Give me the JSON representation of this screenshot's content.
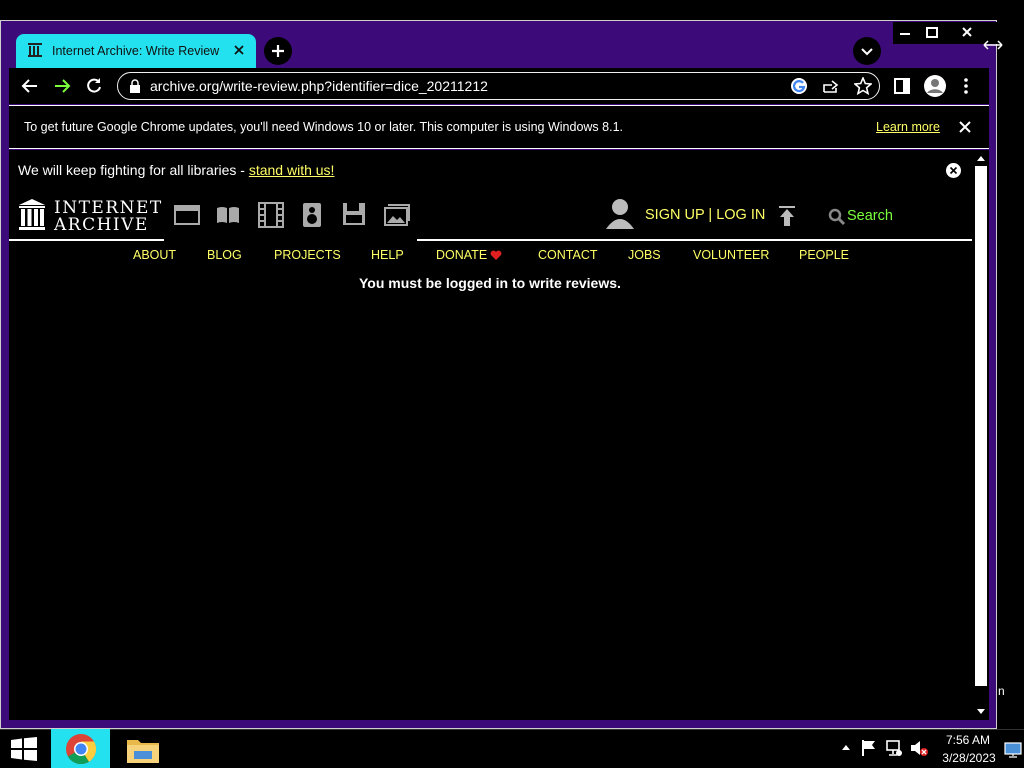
{
  "colors": {
    "frame": "#3d0a7a",
    "tab_active": "#23e1ef",
    "link_yellow": "#ffff66",
    "search_green": "#7cff3c",
    "heart": "#e02020"
  },
  "browser": {
    "tab_title": "Internet Archive: Write Review",
    "url": "archive.org/write-review.php?identifier=dice_20211212",
    "infobar_text": "To get future Google Chrome updates, you'll need Windows 10 or later. This computer is using Windows 8.1.",
    "infobar_link": "Learn more"
  },
  "banner": {
    "text": "We will keep fighting for all libraries - ",
    "link": "stand with us!"
  },
  "header": {
    "logo_line1": "INTERNET",
    "logo_line2": "ARCHIVE",
    "signup": "SIGN UP",
    "separator": "|",
    "login": "LOG IN",
    "search": "Search",
    "media_icons": [
      "web-icon",
      "texts-icon",
      "video-icon",
      "audio-icon",
      "software-icon",
      "images-icon"
    ]
  },
  "nav": {
    "items": [
      "ABOUT",
      "BLOG",
      "PROJECTS",
      "HELP",
      "DONATE",
      "CONTACT",
      "JOBS",
      "VOLUNTEER",
      "PEOPLE"
    ]
  },
  "main": {
    "message": "You must be logged in to write reviews."
  },
  "taskbar": {
    "time": "7:56 AM",
    "date": "3/28/2023",
    "edge_char": "n"
  }
}
